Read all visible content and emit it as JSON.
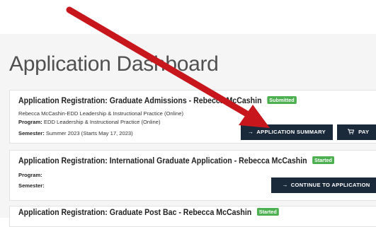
{
  "page": {
    "title": "Application Dashboard"
  },
  "cards": [
    {
      "label": "Application Registration:",
      "name": "Graduate Admissions - Rebecca McCashin",
      "badge": "Submitted",
      "line1": "Rebecca McCashin-EDD Leadership & Instructional Practice (Online)",
      "program_label": "Program:",
      "program_value": "EDD Leadership & Instructional Practice (Online)",
      "semester_label": "Semester:",
      "semester_value": "Summer 2023 (Starts May 17, 2023)",
      "buttons": {
        "summary": "APPLICATION SUMMARY",
        "pay": "PAY"
      }
    },
    {
      "label": "Application Registration:",
      "name": "International Graduate Application - Rebecca McCashin",
      "badge": "Started",
      "program_label": "Program:",
      "semester_label": "Semester:",
      "buttons": {
        "continue": "CONTINUE TO APPLICATION"
      }
    },
    {
      "label": "Application Registration:",
      "name": "Graduate Post Bac - Rebecca McCashin",
      "badge": "Started"
    }
  ],
  "icons": {
    "summary": "arrow-right-icon",
    "pay": "cart-icon",
    "continue": "arrow-right-icon"
  },
  "colors": {
    "button_bg": "#1b2a3b",
    "badge_green": "#4caf50",
    "annotation_arrow": "#c8161d"
  }
}
